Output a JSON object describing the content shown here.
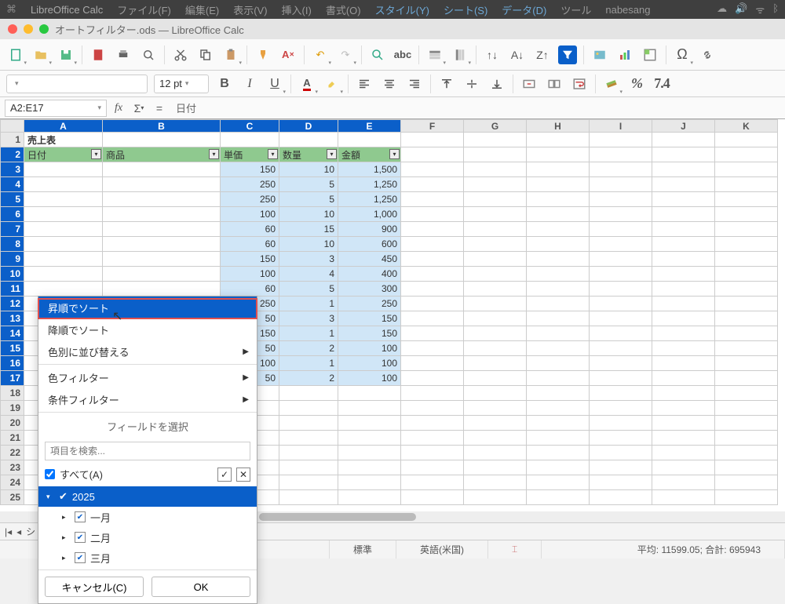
{
  "mac_menu": {
    "app": "LibreOffice Calc",
    "items": [
      "ファイル(F)",
      "編集(E)",
      "表示(V)",
      "挿入(I)",
      "書式(O)",
      "スタイル(Y)",
      "シート(S)",
      "データ(D)",
      "ツール"
    ],
    "user": "nabesang"
  },
  "window_title": "オートフィルター.ods — LibreOffice Calc",
  "format": {
    "size": "12 pt"
  },
  "formula": {
    "ref": "A2:E17",
    "content": "日付"
  },
  "columns": [
    "A",
    "B",
    "C",
    "D",
    "E",
    "F",
    "G",
    "H",
    "I",
    "J",
    "K"
  ],
  "title_cell": "売上表",
  "headers": [
    "日付",
    "商品",
    "単価",
    "数量",
    "金額"
  ],
  "rows": [
    {
      "c": 150,
      "d": 10,
      "e": "1,500"
    },
    {
      "c": 250,
      "d": 5,
      "e": "1,250"
    },
    {
      "c": 250,
      "d": 5,
      "e": "1,250"
    },
    {
      "c": 100,
      "d": 10,
      "e": "1,000"
    },
    {
      "c": 60,
      "d": 15,
      "e": "900"
    },
    {
      "c": 60,
      "d": 10,
      "e": "600"
    },
    {
      "c": 150,
      "d": 3,
      "e": "450"
    },
    {
      "c": 100,
      "d": 4,
      "e": "400"
    },
    {
      "c": 60,
      "d": 5,
      "e": "300"
    },
    {
      "c": 250,
      "d": 1,
      "e": "250"
    },
    {
      "c": 50,
      "d": 3,
      "e": "150"
    },
    {
      "c": 150,
      "d": 1,
      "e": "150"
    },
    {
      "c": 50,
      "d": 2,
      "e": "100"
    },
    {
      "c": 100,
      "d": 1,
      "e": "100"
    },
    {
      "c": 50,
      "d": 2,
      "e": "100"
    }
  ],
  "popup": {
    "sort_asc": "昇順でソート",
    "sort_desc": "降順でソート",
    "sort_color": "色別に並び替える",
    "filter_color": "色フィルター",
    "filter_cond": "条件フィルター",
    "field_label": "フィールドを選択",
    "search_ph": "項目を検索...",
    "all": "すべて(A)",
    "year": "2025",
    "months": [
      "一月",
      "二月",
      "三月"
    ],
    "cancel": "キャンセル(C)",
    "ok": "OK"
  },
  "status": {
    "normal": "標準",
    "lang": "英語(米国)",
    "stats": "平均: 11599.05; 合計: 695943"
  },
  "tabbar_label": "シ"
}
